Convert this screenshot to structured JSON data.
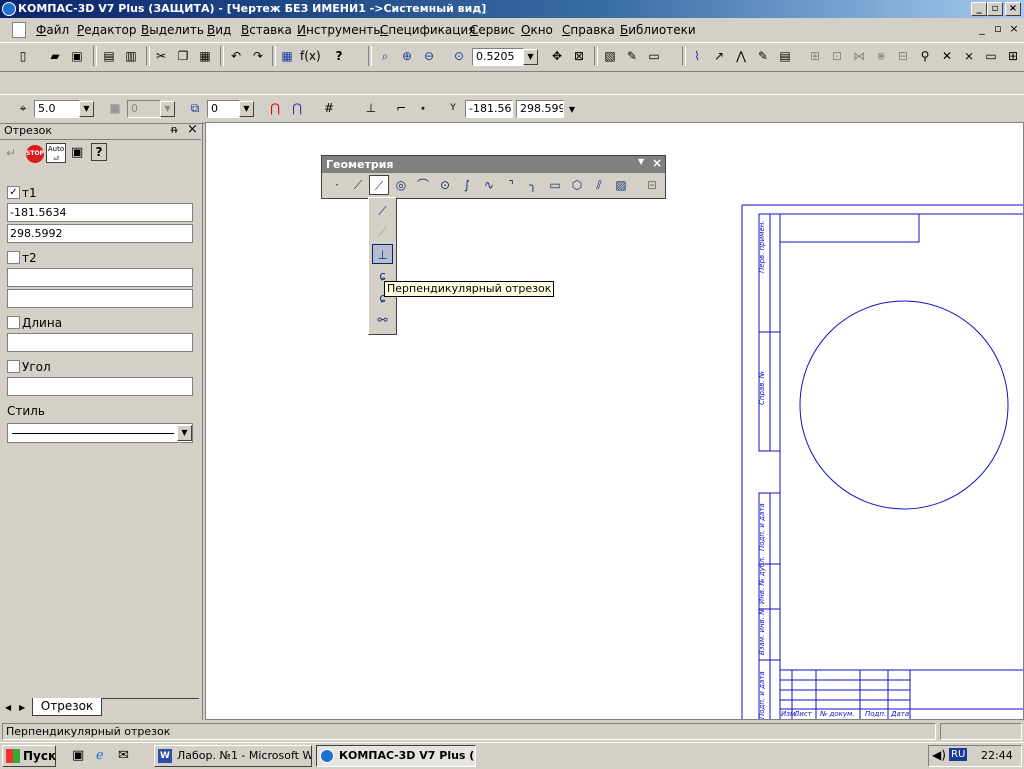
{
  "window": {
    "title": "КОМПАС-3D V7 Plus (ЗАЩИТА) - [Чертеж БЕЗ ИМЕНИ1 ->Системный вид]",
    "minimize": "_",
    "maximize": "▫",
    "close": "×"
  },
  "menu": {
    "items": [
      "Файл",
      "Редактор",
      "Выделить",
      "Вид",
      "Вставка",
      "Инструменты",
      "Спецификация",
      "Сервис",
      "Окно",
      "Справка",
      "Библиотеки"
    ],
    "doc_minimize": "_",
    "doc_restore": "▫",
    "doc_close": "×"
  },
  "toolbar": {
    "zoom_value": "0.5205",
    "step_value": "5.0",
    "layer_value": "0",
    "view_value": "0",
    "coord_x": "-181.56",
    "coord_y": "298.599",
    "coord_label": "Y"
  },
  "panel": {
    "title": "Отрезок",
    "pin": "ᵰ",
    "close": "×",
    "t1": {
      "label": "т1",
      "checked": true,
      "x": "-181.5634",
      "y": "298.5992"
    },
    "t2": {
      "label": "т2",
      "checked": false,
      "x": "",
      "y": ""
    },
    "length": {
      "label": "Длина",
      "value": ""
    },
    "angle": {
      "label": "Угол",
      "value": ""
    },
    "style_label": "Стиль",
    "tab_label": "Отрезок"
  },
  "geometry_panel": {
    "title": "Геометрия",
    "tooltip": "Перпендикулярный отрезок"
  },
  "title_block": {
    "side_labels": [
      "Перв. примен.",
      "Справ. №",
      "Подп. и дата",
      "Инв. № дубл.",
      "Взам. инв. №",
      "Подп. и дата"
    ],
    "bottom_labels": [
      "Изм.",
      "Лист",
      "№ докум.",
      "Подп.",
      "Дата"
    ]
  },
  "status": {
    "text": "Перпендикулярный отрезок"
  },
  "taskbar": {
    "start": "Пуск",
    "tasks": [
      "Лабор. №1 - Microsoft W...",
      "КОМПАС-3D V7 Plus (З..."
    ],
    "lang": "RU",
    "clock": "22:44"
  },
  "colors": {
    "titlebar_start": "#0a246a",
    "titlebar_end": "#a6caf0",
    "face": "#d4d0c8",
    "drawing_line": "#1010c8",
    "tooltip_bg": "#ffffe1"
  }
}
